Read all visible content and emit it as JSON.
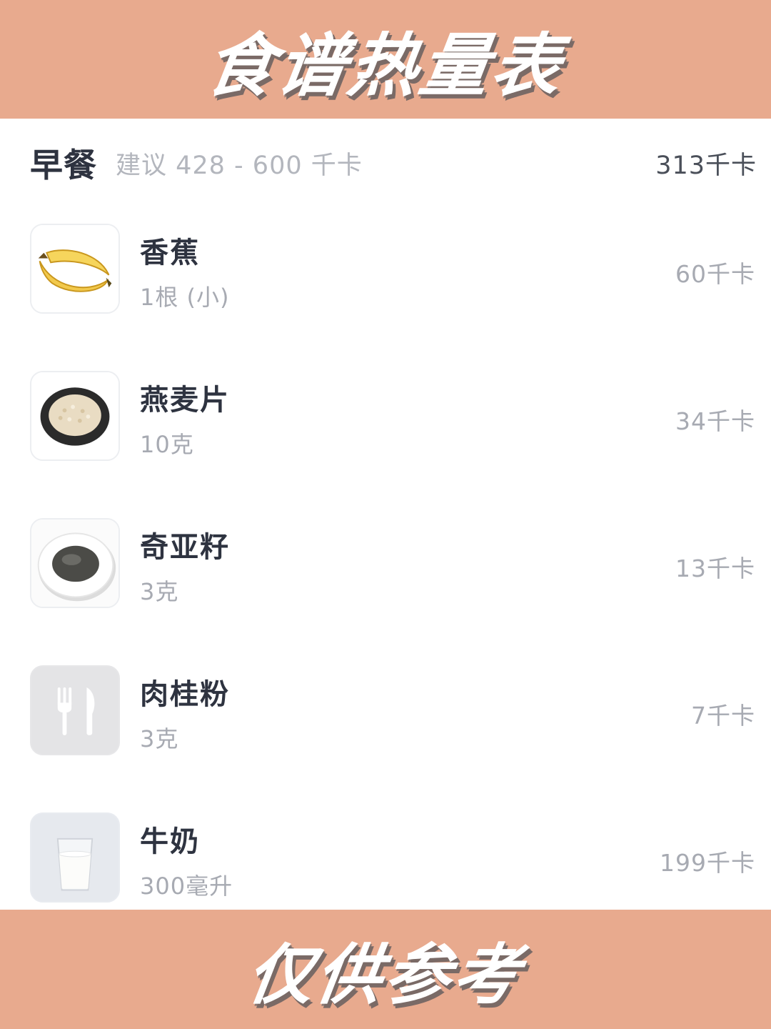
{
  "banner_top": {
    "title": "食谱热量表"
  },
  "meal": {
    "title": "早餐",
    "suggestion": "建议 428 - 600 千卡",
    "total": "313千卡"
  },
  "foods": [
    {
      "name": "香蕉",
      "amount": "1根 (小)",
      "kcal": "60千卡",
      "icon": "banana-icon"
    },
    {
      "name": "燕麦片",
      "amount": "10克",
      "kcal": "34千卡",
      "icon": "oatmeal-icon"
    },
    {
      "name": "奇亚籽",
      "amount": "3克",
      "kcal": "13千卡",
      "icon": "chia-seeds-icon"
    },
    {
      "name": "肉桂粉",
      "amount": "3克",
      "kcal": "7千卡",
      "icon": "fork-knife-icon"
    },
    {
      "name": "牛奶",
      "amount": "300毫升",
      "kcal": "199千卡",
      "icon": "milk-glass-icon"
    }
  ],
  "banner_bottom": {
    "title": "仅供参考"
  },
  "colors": {
    "banner": "#e8aa8e",
    "title_text": "#2e3340",
    "muted_text": "#a7aab2"
  }
}
